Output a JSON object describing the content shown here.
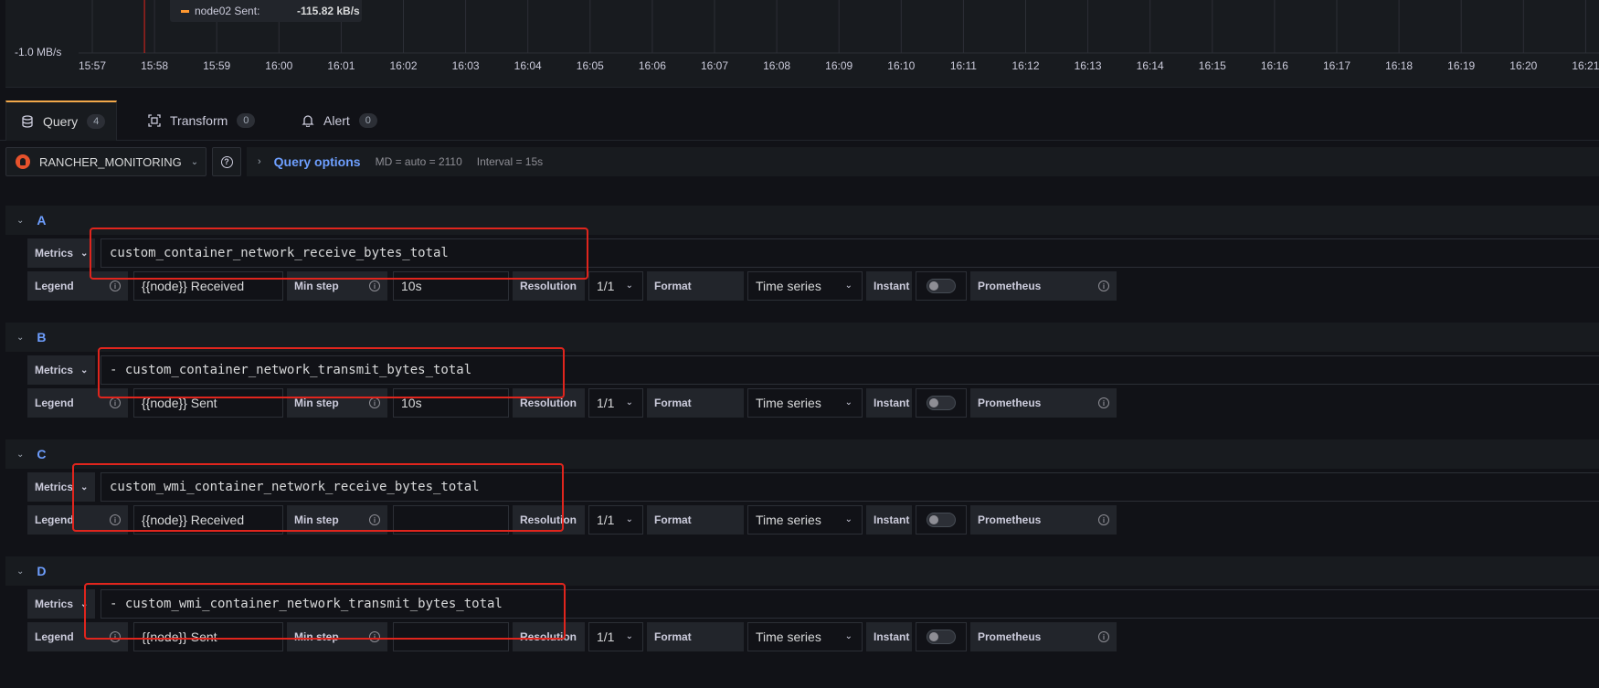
{
  "graph": {
    "y_label": "-1.0 MB/s",
    "x_ticks": [
      "15:57",
      "15:58",
      "15:59",
      "16:00",
      "16:01",
      "16:02",
      "16:03",
      "16:04",
      "16:05",
      "16:06",
      "16:07",
      "16:08",
      "16:09",
      "16:10",
      "16:11",
      "16:12",
      "16:13",
      "16:14",
      "16:15",
      "16:16",
      "16:17",
      "16:18",
      "16:19",
      "16:20",
      "16:21"
    ],
    "tooltip": {
      "series": "node02 Sent:",
      "value": "-115.82 kB/s",
      "color": "#ff9830"
    }
  },
  "tabs": [
    {
      "label": "Query",
      "count": "4",
      "icon": "database-icon"
    },
    {
      "label": "Transform",
      "count": "0",
      "icon": "transform-icon"
    },
    {
      "label": "Alert",
      "count": "0",
      "icon": "bell-icon"
    }
  ],
  "datasource": {
    "name": "RANCHER_MONITORING",
    "help": "?"
  },
  "query_options": {
    "label": "Query options",
    "md": "MD = auto = 2110",
    "interval": "Interval = 15s"
  },
  "labels": {
    "metrics": "Metrics",
    "legend": "Legend",
    "min_step": "Min step",
    "resolution": "Resolution",
    "format": "Format",
    "instant": "Instant",
    "prometheus": "Prometheus",
    "info": "i"
  },
  "queries": [
    {
      "letter": "A",
      "metric": "custom_container_network_receive_bytes_total",
      "legend": "{{node}} Received",
      "min_step": "10s",
      "resolution": "1/1",
      "format": "Time series"
    },
    {
      "letter": "B",
      "metric": "- custom_container_network_transmit_bytes_total",
      "legend": "{{node}} Sent",
      "min_step": "10s",
      "resolution": "1/1",
      "format": "Time series"
    },
    {
      "letter": "C",
      "metric": "custom_wmi_container_network_receive_bytes_total",
      "legend": "{{node}} Received",
      "min_step": "",
      "resolution": "1/1",
      "format": "Time series"
    },
    {
      "letter": "D",
      "metric": "- custom_wmi_container_network_transmit_bytes_total",
      "legend": "{{node}} Sent",
      "min_step": "",
      "resolution": "1/1",
      "format": "Time series"
    }
  ],
  "colors": {
    "accent": "#6e9fff",
    "active_tab": "#f2a84a",
    "highlight": "#e0251d",
    "crosshair": "#e0251d"
  }
}
